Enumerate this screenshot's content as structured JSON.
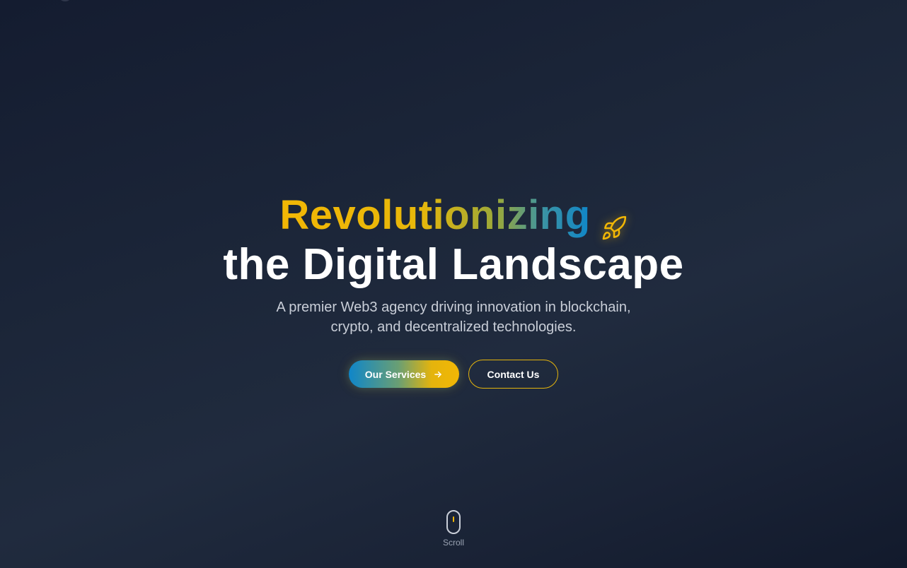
{
  "hero": {
    "headline_gradient_word": "Revolutionizing",
    "headline_line2": "the Digital Landscape",
    "headline_icon": "rocket-icon",
    "subtitle_line1": "A premier Web3 agency driving innovation in blockchain,",
    "subtitle_line2": "crypto, and decentralized technologies.",
    "primary_button": {
      "label": "Our Services",
      "icon": "arrow-right-icon"
    },
    "secondary_button": {
      "label": "Contact Us"
    },
    "scroll": {
      "label": "Scroll",
      "icon": "mouse-icon"
    }
  },
  "colors": {
    "accent_gold": "#f2b705",
    "accent_blue": "#0f86c9",
    "background_dark": "#1b2538",
    "text_muted": "#c9ced8"
  }
}
